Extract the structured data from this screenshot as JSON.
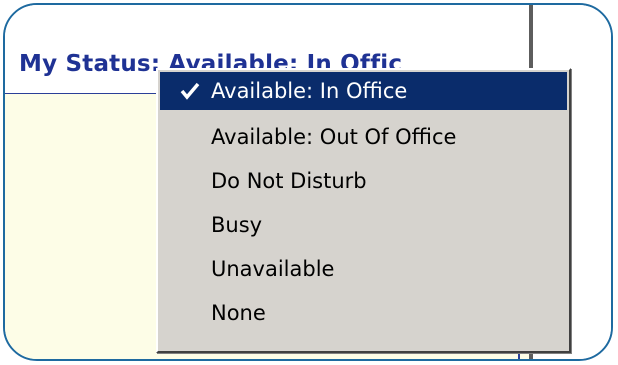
{
  "status": {
    "label": "My Status: Available: In Offic"
  },
  "menu": {
    "items": [
      {
        "label": "Available: In Office",
        "checked": true
      },
      {
        "label": "Available: Out Of Office",
        "checked": false
      },
      {
        "label": "Do Not Disturb",
        "checked": false
      },
      {
        "label": "Busy",
        "checked": false
      },
      {
        "label": "Unavailable",
        "checked": false
      },
      {
        "label": "None",
        "checked": false
      }
    ],
    "selected_index": 0,
    "check_icon": "checkmark-icon"
  },
  "colors": {
    "border_accent": "#1e6aa0",
    "status_text": "#1f3294",
    "menu_bg": "#d6d3ce",
    "menu_highlight": "#0a2c6b",
    "panel_bg": "#fdfde7"
  }
}
